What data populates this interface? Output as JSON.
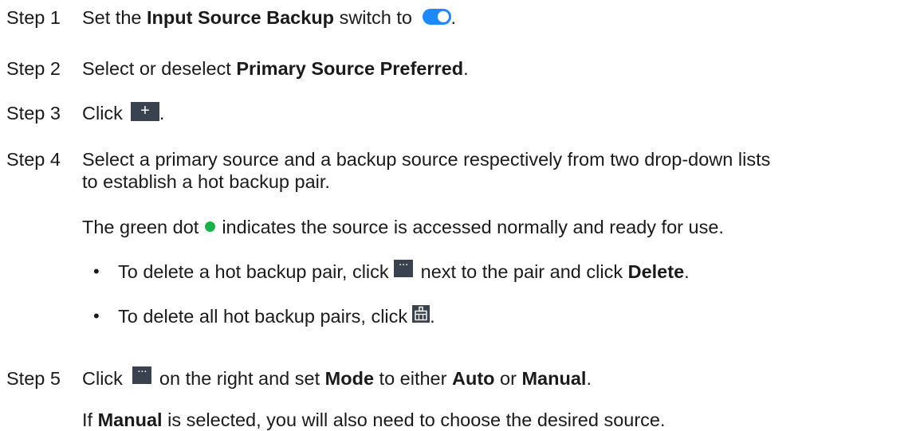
{
  "steps": [
    {
      "label": "Step 1",
      "pre": "Set the ",
      "bold": "Input Source Backup",
      "post": " switch to ",
      "end": "."
    },
    {
      "label": "Step 2",
      "pre": "Select or deselect ",
      "bold": "Primary Source Preferred",
      "end": "."
    },
    {
      "label": "Step 3",
      "pre": "Click",
      "end": "."
    },
    {
      "label": "Step 4",
      "line1": "Select a primary source and a backup source respectively from two drop-down lists",
      "line2": "to establish a hot backup pair.",
      "note_pre": "The green dot",
      "note_post": "indicates the source is accessed normally and ready for use.",
      "bullets": [
        {
          "pre": "To delete a hot backup pair, click",
          "mid": "next to the pair and click ",
          "bold": "Delete",
          "end": "."
        },
        {
          "pre": "To delete all hot backup pairs, click",
          "end": "."
        }
      ]
    },
    {
      "label": "Step 5",
      "pre": "Click",
      "mid": "on the right and set ",
      "bold1": "Mode",
      "mid2": " to either ",
      "bold2": "Auto",
      "mid3": " or ",
      "bold3": "Manual",
      "end": ".",
      "note_pre": "If ",
      "note_bold": "Manual",
      "note_post": " is selected, you will also need to choose the desired source."
    }
  ],
  "icons": {
    "toggle": "toggle-switch-on",
    "plus": "plus-icon",
    "more": "more-icon",
    "clear": "clear-all-icon",
    "status": "green-dot-icon"
  },
  "bullet_char": "•",
  "plus_char": "+",
  "more_char": "···",
  "colors": {
    "toggle": "#1e88ff",
    "button": "#3a4250",
    "green": "#17b34a"
  }
}
